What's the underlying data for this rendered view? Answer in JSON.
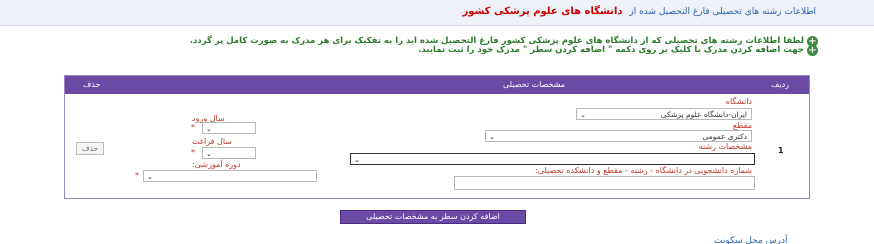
{
  "header": {
    "prefix": "اطلاعات رشته های تحصیلی فارغ التحصیل شده از",
    "university": "دانشگاه های علوم پزشکی کشور"
  },
  "notes": {
    "line1": "لطفا اطلاعات رشته های تحصیلی که از دانشگاه های علوم پزشکی کشور فارغ التحصیل شده اید را به تفکیک برای هر مدرک به صورت کامل پر گردد.",
    "line2": "جهت اضافه کردن مدرک با کلیک بر روی دکمه \" اضافه کردن سطر \" مدرک خود را ثبت نمایید."
  },
  "table": {
    "headers": {
      "row": "ردیف",
      "details": "مشخصات تحصیلی",
      "delete": "حذف"
    },
    "row_number": "1",
    "delete_label": "حذف",
    "university_label": "دانشگاه",
    "university_value": "ایران-دانشگاه علوم پزشکی",
    "degree_label": "مقطع",
    "degree_value": "دکتری عمومی",
    "major_label": "مشخصات رشته",
    "major_value": "",
    "student_no_label": "شماره دانشجویی در دانشگاه - رشته - مقطع و دانشکده تحصیلی:",
    "entry_year_label": "سال ورود",
    "grad_year_label": "سال فراغت",
    "course_label": "دوره آموزشی:",
    "required_mark": "*"
  },
  "add_row_label": "اضافه کردن سطر به مشخصات تحصیلی",
  "footer_text": "آدرس محل سکونت"
}
